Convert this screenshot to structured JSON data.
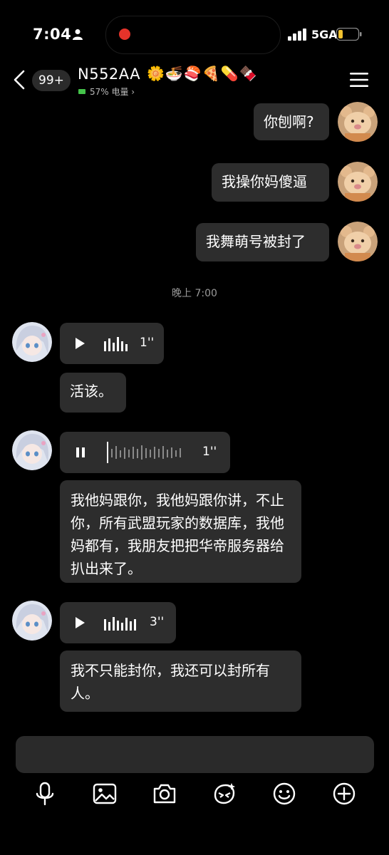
{
  "status_bar": {
    "time": "7:04",
    "network": "5GA",
    "icons": [
      "person-icon",
      "recording-dot",
      "signal-icon",
      "battery-icon"
    ]
  },
  "header": {
    "unread_badge": "99+",
    "contact_name": "N552AA",
    "contact_emoji": "🌼🍜🍣🍕💊🍫",
    "battery_status": "57% 电量 ›",
    "icons": [
      "back-arrow-icon",
      "menu-icon"
    ]
  },
  "messages": {
    "out_1": "你刨啊?",
    "out_2": "我操你妈傻逼",
    "out_3": "我舞萌号被封了",
    "time_divider": "晚上 7:00",
    "voice_1_duration": "1''",
    "in_1": "活该。",
    "voice_2_duration": "1''",
    "in_2": "我他妈跟你，我他妈跟你讲，不止你，所有武盟玩家的数据库，我他妈都有，我朋友把把华帝服务器给扒出来了。",
    "voice_3_duration": "3''",
    "in_3": "我不只能封你，我还可以封所有人。"
  },
  "toolbar": {
    "icons": [
      "microphone-icon",
      "image-icon",
      "camera-icon",
      "sticker-icon",
      "emoji-icon",
      "plus-icon"
    ]
  },
  "colors": {
    "background": "#000000",
    "bubble": "#2d2d2d",
    "recording": "#e5332a",
    "battery_low": "#f2c230"
  }
}
